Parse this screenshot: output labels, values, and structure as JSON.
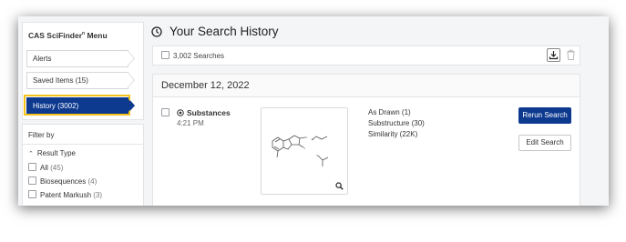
{
  "sidebar": {
    "menu_title": "CAS SciFinder",
    "menu_title_sup": "n",
    "menu_title_suffix": " Menu",
    "items": [
      {
        "label": "Alerts"
      },
      {
        "label": "Saved Items  (15)"
      },
      {
        "label": "History  (3002)",
        "active": true
      }
    ]
  },
  "filter": {
    "title": "Filter by",
    "section": "Result Type",
    "options": [
      {
        "label": "All",
        "count": "(45)"
      },
      {
        "label": "Biosequences",
        "count": "(4)"
      },
      {
        "label": "Patent Markush",
        "count": "(3)"
      }
    ]
  },
  "page": {
    "title": "Your Search History",
    "count": "3,002 Searches"
  },
  "history": {
    "date": "December 12, 2022",
    "entry": {
      "type": "Substances",
      "time": "4:21 PM",
      "results": [
        "As Drawn (1)",
        "Substructure (30)",
        "Similarity (22K)"
      ],
      "rerun_label": "Rerun Search",
      "edit_label": "Edit Search"
    }
  },
  "colors": {
    "primary": "#0d3a8f",
    "highlight": "#f3c21b"
  }
}
